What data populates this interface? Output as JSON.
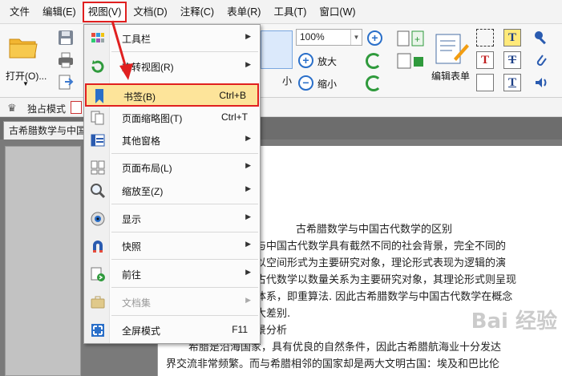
{
  "menubar": {
    "items": [
      "文件",
      "编辑(E)",
      "视图(V)",
      "文档(D)",
      "注释(C)",
      "表单(R)",
      "工具(T)",
      "窗口(W)"
    ]
  },
  "ribbon": {
    "open_label": "打开(O)...",
    "zoom_value": "100%",
    "zoom_in_label": "放大",
    "zoom_out_label": "缩小",
    "form_edit_label": "编辑表单",
    "partial_label": "小"
  },
  "toolrow": {
    "exclusive_mode": "独占模式"
  },
  "tabs": {
    "doc_tab": "古希腊数学与中国"
  },
  "view_menu": {
    "items": [
      {
        "label": "工具栏",
        "shortcut": "",
        "submenu": true,
        "icon": "toolbar-grid-icon"
      },
      {
        "label": "旋转视图(R)",
        "shortcut": "",
        "submenu": true,
        "icon": "rotate-view-icon"
      },
      {
        "label": "书签(B)",
        "shortcut": "Ctrl+B",
        "submenu": false,
        "icon": "bookmark-icon"
      },
      {
        "label": "页面缩略图(T)",
        "shortcut": "Ctrl+T",
        "submenu": false,
        "icon": "page-thumbnails-icon"
      },
      {
        "label": "其他窗格",
        "shortcut": "",
        "submenu": true,
        "icon": "other-panes-icon"
      },
      {
        "label": "页面布局(L)",
        "shortcut": "",
        "submenu": true,
        "icon": "page-layout-icon"
      },
      {
        "label": "缩放至(Z)",
        "shortcut": "",
        "submenu": true,
        "icon": "zoom-to-icon"
      },
      {
        "label": "显示",
        "shortcut": "",
        "submenu": true,
        "icon": "display-eye-icon"
      },
      {
        "label": "快照",
        "shortcut": "",
        "submenu": true,
        "icon": "snapshot-magnet-icon"
      },
      {
        "label": "前往",
        "shortcut": "",
        "submenu": true,
        "icon": "goto-icon"
      },
      {
        "label": "文档集",
        "shortcut": "",
        "submenu": true,
        "icon": "document-set-icon",
        "disabled": true
      },
      {
        "label": "全屏模式",
        "shortcut": "F11",
        "submenu": false,
        "icon": "fullscreen-icon"
      }
    ]
  },
  "document": {
    "lines": [
      "古希腊数学与中国古代数学的区别",
      "与中国古代数学具有截然不同的社会背景，完全不同的",
      "以空间形式为主要研究对象，理论形式表现为逻辑的演",
      "古代数学以数量关系为主要研究对象，其理论形式则呈现",
      "体系，即重算法. 因此古希腊数学与中国古代数学在概念",
      "大差别.",
      "景分析",
      "希腊是沿海国家，具有优良的自然条件，因此古希腊航海业十分发达",
      "界交流非常频繁。而与希腊相邻的国家却是两大文明古国：埃及和巴比伦"
    ]
  },
  "watermark": "Bai 经验"
}
